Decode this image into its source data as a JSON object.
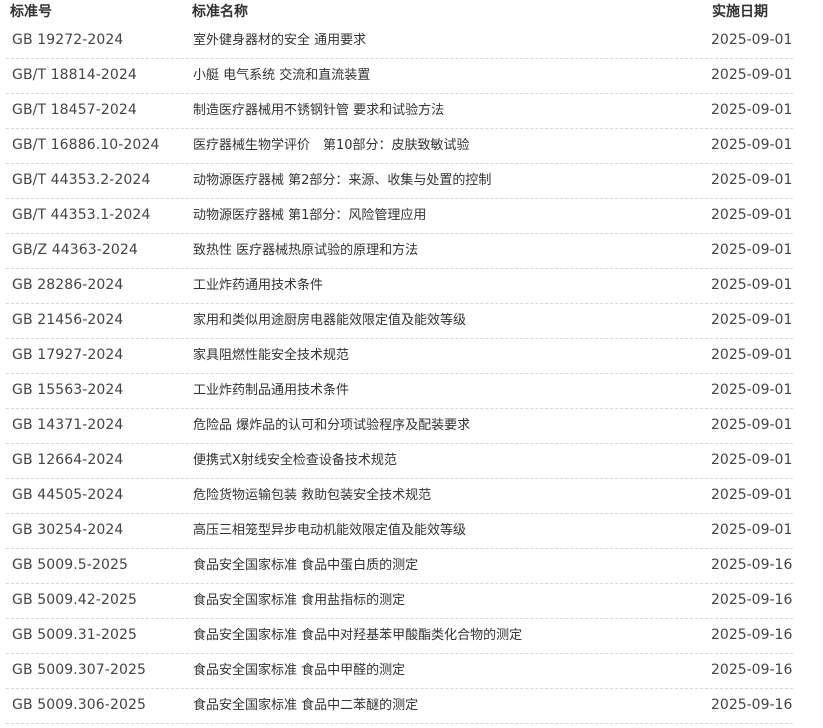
{
  "header": {
    "code": "标准号",
    "name": "标准名称",
    "date": "实施日期"
  },
  "rows": [
    {
      "code": "GB 19272-2024",
      "name": "室外健身器材的安全 通用要求",
      "date": "2025-09-01"
    },
    {
      "code": "GB/T 18814-2024",
      "name": "小艇 电气系统 交流和直流装置",
      "date": "2025-09-01"
    },
    {
      "code": "GB/T 18457-2024",
      "name": "制造医疗器械用不锈钢针管 要求和试验方法",
      "date": "2025-09-01"
    },
    {
      "code": "GB/T 16886.10-2024",
      "name": "医疗器械生物学评价　第10部分：皮肤致敏试验",
      "date": "2025-09-01"
    },
    {
      "code": "GB/T 44353.2-2024",
      "name": "动物源医疗器械 第2部分：来源、收集与处置的控制",
      "date": "2025-09-01"
    },
    {
      "code": "GB/T 44353.1-2024",
      "name": "动物源医疗器械 第1部分：风险管理应用",
      "date": "2025-09-01"
    },
    {
      "code": "GB/Z 44363-2024",
      "name": "致热性 医疗器械热原试验的原理和方法",
      "date": "2025-09-01"
    },
    {
      "code": "GB 28286-2024",
      "name": "工业炸药通用技术条件",
      "date": "2025-09-01"
    },
    {
      "code": "GB 21456-2024",
      "name": "家用和类似用途厨房电器能效限定值及能效等级",
      "date": "2025-09-01"
    },
    {
      "code": "GB 17927-2024",
      "name": "家具阻燃性能安全技术规范",
      "date": "2025-09-01"
    },
    {
      "code": "GB 15563-2024",
      "name": "工业炸药制品通用技术条件",
      "date": "2025-09-01"
    },
    {
      "code": "GB 14371-2024",
      "name": "危险品 爆炸品的认可和分项试验程序及配装要求",
      "date": "2025-09-01"
    },
    {
      "code": "GB 12664-2024",
      "name": "便携式X射线安全检查设备技术规范",
      "date": "2025-09-01"
    },
    {
      "code": "GB 44505-2024",
      "name": "危险货物运输包装 救助包装安全技术规范",
      "date": "2025-09-01"
    },
    {
      "code": "GB 30254-2024",
      "name": "高压三相笼型异步电动机能效限定值及能效等级",
      "date": "2025-09-01"
    },
    {
      "code": "GB 5009.5-2025",
      "name": "食品安全国家标准 食品中蛋白质的测定",
      "date": "2025-09-16"
    },
    {
      "code": "GB 5009.42-2025",
      "name": "食品安全国家标准 食用盐指标的测定",
      "date": "2025-09-16"
    },
    {
      "code": "GB 5009.31-2025",
      "name": "食品安全国家标准 食品中对羟基苯甲酸酯类化合物的测定",
      "date": "2025-09-16"
    },
    {
      "code": "GB 5009.307-2025",
      "name": "食品安全国家标准 食品中甲醛的测定",
      "date": "2025-09-16"
    },
    {
      "code": "GB 5009.306-2025",
      "name": "食品安全国家标准 食品中二苯醚的测定",
      "date": "2025-09-16"
    }
  ]
}
